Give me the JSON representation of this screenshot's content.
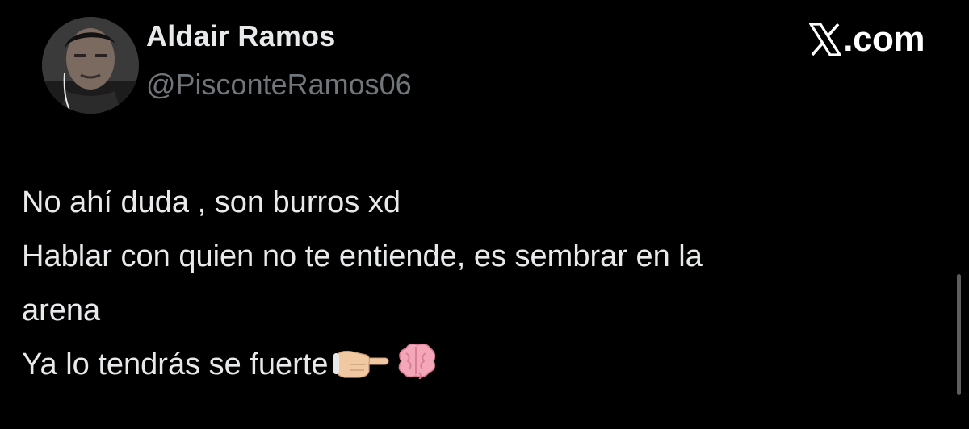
{
  "author": {
    "display_name": "Aldair Ramos",
    "handle": "@PisconteRamos06",
    "avatar_icon": "profile-photo"
  },
  "brand": {
    "logo_icon": "x-logo-icon",
    "label": ".com"
  },
  "tweet": {
    "lines": [
      "No ahí duda , son burros xd",
      "Hablar con quien no te entiende, es sembrar en la",
      "arena",
      "Ya lo tendrás se fuerte"
    ],
    "emojis": [
      "pointing-hand-emoji",
      "brain-emoji"
    ]
  },
  "colors": {
    "background": "#000000",
    "text_primary": "#e7e9ea",
    "text_secondary": "#71767b"
  }
}
